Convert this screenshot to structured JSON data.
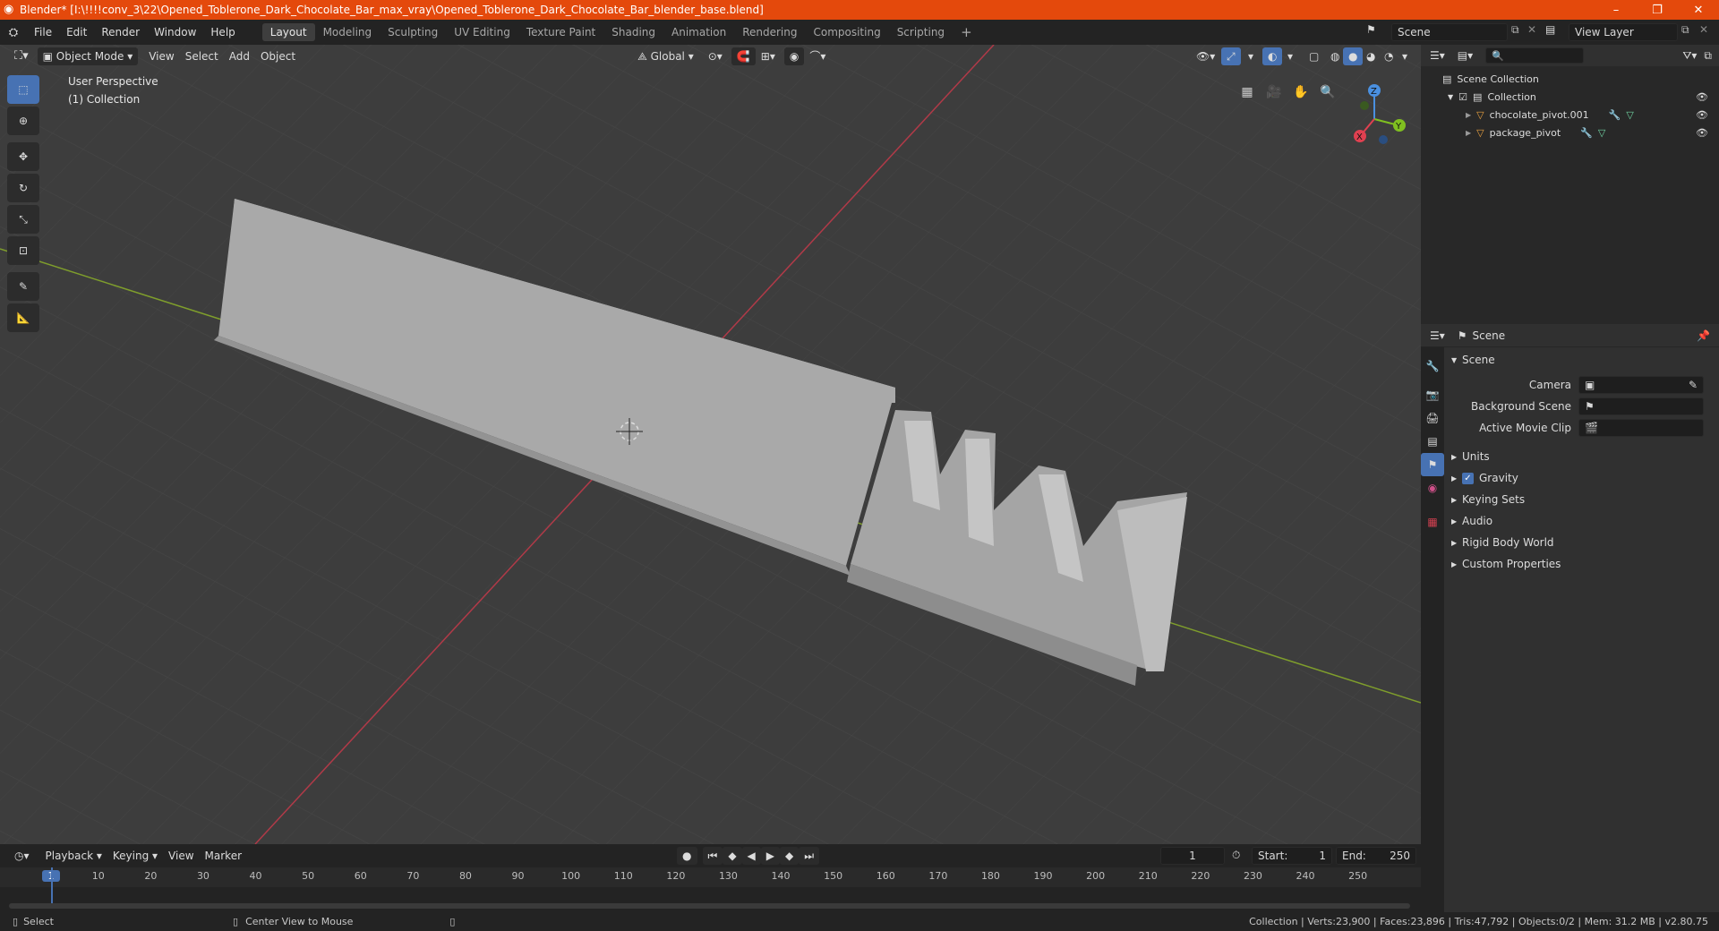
{
  "window": {
    "title": "Blender* [I:\\!!!!conv_3\\22\\Opened_Toblerone_Dark_Chocolate_Bar_max_vray\\Opened_Toblerone_Dark_Chocolate_Bar_blender_base.blend]",
    "controls": [
      "–",
      "❐",
      "✕"
    ]
  },
  "menu": [
    "File",
    "Edit",
    "Render",
    "Window",
    "Help"
  ],
  "workspaces": [
    "Layout",
    "Modeling",
    "Sculpting",
    "UV Editing",
    "Texture Paint",
    "Shading",
    "Animation",
    "Rendering",
    "Compositing",
    "Scripting"
  ],
  "active_workspace": "Layout",
  "add_workspace": "+",
  "scene_selector": "Scene",
  "view_layer": "View Layer",
  "viewport": {
    "mode": "Object Mode",
    "menus": [
      "View",
      "Select",
      "Add",
      "Object"
    ],
    "orientation": "Global",
    "overlay_title": "User Perspective",
    "overlay_subtitle": "(1) Collection",
    "gizmo_axes": {
      "x": "X",
      "y": "Y",
      "z": "Z"
    }
  },
  "outliner": {
    "root": "Scene Collection",
    "collection": "Collection",
    "objects": [
      "chocolate_pivot.001",
      "package_pivot"
    ]
  },
  "properties": {
    "header": "Scene",
    "panel": "Scene",
    "fields": [
      {
        "label": "Camera"
      },
      {
        "label": "Background Scene"
      },
      {
        "label": "Active Movie Clip"
      }
    ],
    "sections": [
      "Units",
      "Gravity",
      "Keying Sets",
      "Audio",
      "Rigid Body World",
      "Custom Properties"
    ],
    "gravity_checked": true
  },
  "timeline": {
    "menus": [
      "Playback",
      "Keying",
      "View",
      "Marker"
    ],
    "current_frame": "1",
    "start_label": "Start:",
    "start": "1",
    "end_label": "End:",
    "end": "250",
    "ruler": [
      "1",
      "10",
      "20",
      "30",
      "40",
      "50",
      "60",
      "70",
      "80",
      "90",
      "100",
      "110",
      "120",
      "130",
      "140",
      "150",
      "160",
      "170",
      "180",
      "190",
      "200",
      "210",
      "220",
      "230",
      "240",
      "250"
    ]
  },
  "status": {
    "left": "Select",
    "middle": "Center View to Mouse",
    "right": "Collection | Verts:23,900 | Faces:23,896 | Tris:47,792 | Objects:0/2 | Mem: 31.2 MB | v2.80.75"
  },
  "colors": {
    "accent": "#4772b3",
    "titlebar": "#e4490c",
    "x_axis": "#e04050",
    "y_axis": "#80c020",
    "z_axis": "#4a90e0"
  }
}
